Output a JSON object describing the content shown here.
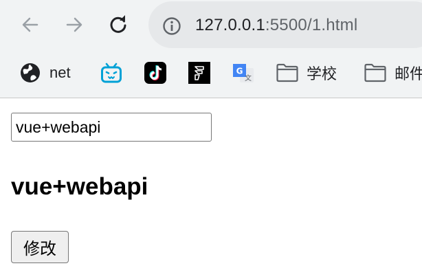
{
  "browser": {
    "url_host": "127.0.0.1",
    "url_rest": ":5500/1.html",
    "bookmarks": [
      {
        "icon": "globe-icon",
        "label": "net"
      },
      {
        "icon": "bilibili-icon",
        "label": ""
      },
      {
        "icon": "tiktok-icon",
        "label": ""
      },
      {
        "icon": "app-logo-icon",
        "label": ""
      },
      {
        "icon": "google-translate-icon",
        "label": ""
      },
      {
        "icon": "folder-icon",
        "label": "学校"
      },
      {
        "icon": "folder-icon",
        "label": "邮件"
      }
    ],
    "colors": {
      "toolbar_bg": "#f1f3f4",
      "omnibox_bg": "#e6e8ea",
      "bilibili": "#00a1d6",
      "tiktok_bg": "#000000"
    }
  },
  "page": {
    "input_value": "vue+webapi",
    "heading": "vue+webapi",
    "button_label": "修改"
  }
}
